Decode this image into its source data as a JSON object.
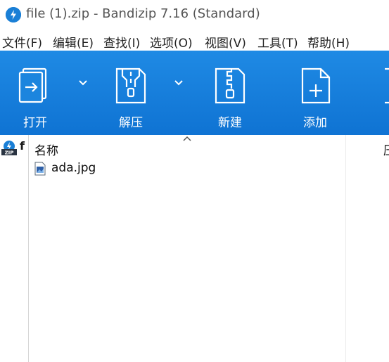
{
  "window": {
    "title": "file (1).zip - Bandizip 7.16 (Standard)"
  },
  "menu": {
    "items": [
      "文件(F)",
      "编辑(E)",
      "查找(I)",
      "选项(O)",
      "视图(V)",
      "工具(T)",
      "帮助(H)"
    ]
  },
  "toolbar": {
    "open_label": "打开",
    "extract_label": "解压",
    "new_label": "新建",
    "add_label": "添加"
  },
  "left_pane": {
    "label": "f"
  },
  "file_list": {
    "name_header": "名称",
    "files": [
      {
        "name": "ada.jpg"
      }
    ]
  },
  "right_pane": {
    "header": "压"
  },
  "colors": {
    "toolbar_top": "#1f8ae4",
    "toolbar_bottom": "#0f73d3",
    "accent": "#1a7fd6"
  }
}
